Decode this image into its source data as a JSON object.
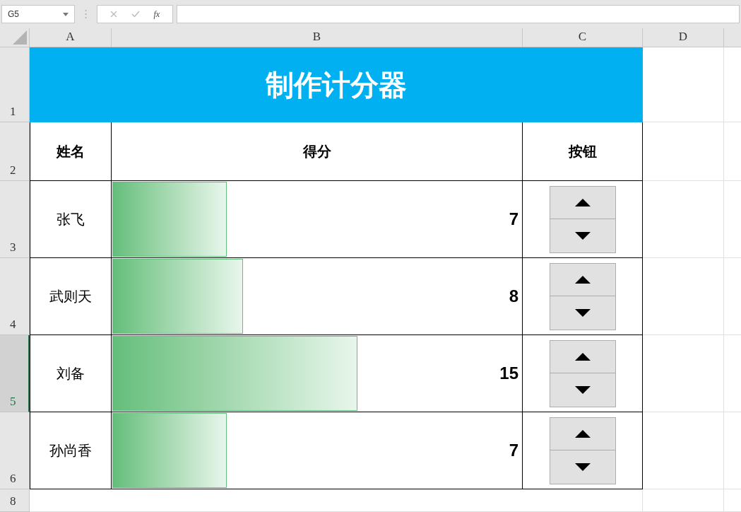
{
  "name_box": {
    "value": "G5"
  },
  "formula_bar": {
    "function_label": "fx"
  },
  "columns": [
    "A",
    "B",
    "C",
    "D"
  ],
  "row_headers": [
    {
      "label": "1",
      "selected": false
    },
    {
      "label": "2",
      "selected": false
    },
    {
      "label": "3",
      "selected": false
    },
    {
      "label": "4",
      "selected": false
    },
    {
      "label": "5",
      "selected": true
    },
    {
      "label": "6",
      "selected": false
    },
    {
      "label": "8",
      "selected": false
    }
  ],
  "title": "制作计分器",
  "headers": [
    "姓名",
    "得分",
    "按钮"
  ],
  "players": [
    {
      "name": "张飞",
      "score": "7",
      "level": 0.28
    },
    {
      "name": "武则天",
      "score": "8",
      "level": 0.32
    },
    {
      "name": "刘备",
      "score": "15",
      "level": 0.6
    },
    {
      "name": "孙尚香",
      "score": "7",
      "level": 0.28
    }
  ]
}
